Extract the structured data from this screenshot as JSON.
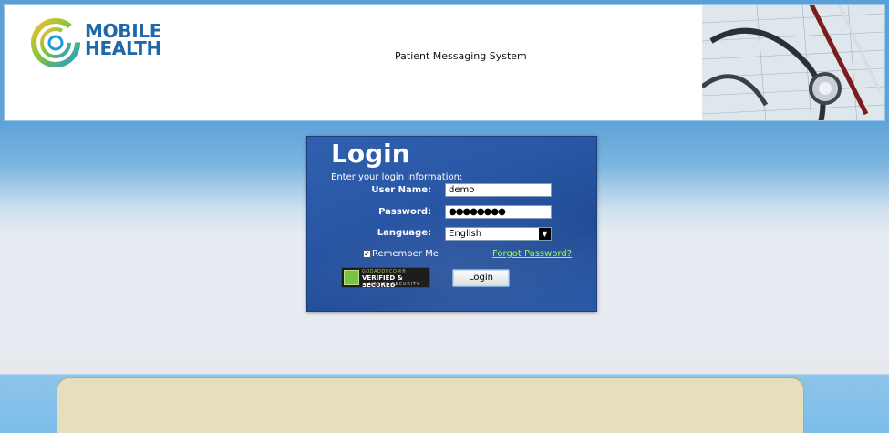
{
  "header": {
    "logo_line1": "MOBILE",
    "logo_line2": "HEALTH",
    "subtitle": "Patient Messaging System"
  },
  "login": {
    "title": "Login",
    "info": "Enter your login information:",
    "username_label": "User Name:",
    "username_value": "demo",
    "password_label": "Password:",
    "password_value": "●●●●●●●●",
    "language_label": "Language:",
    "language_value": "English",
    "remember_label": "Remember Me",
    "remember_checked": true,
    "forgot_label": "Forgot Password?",
    "button_label": "Login"
  },
  "seal": {
    "line1": "GODADDY.COM®",
    "line2": "VERIFIED & SECURED",
    "line3": "VERIFY SECURITY"
  },
  "colors": {
    "brand_blue": "#1e67a8",
    "panel_blue": "#2a58a6",
    "link_green": "#9bff5a",
    "bottom_box": "#e6dfbd"
  }
}
